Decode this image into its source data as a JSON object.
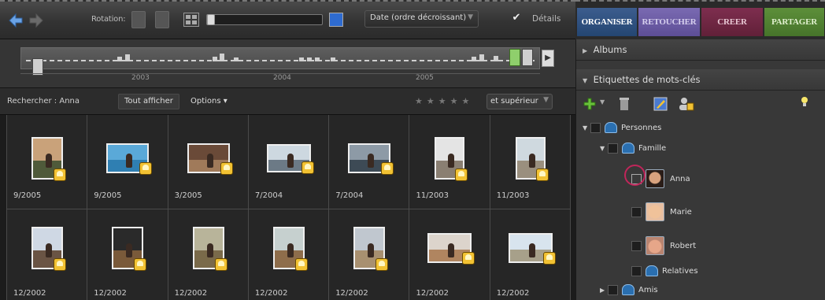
{
  "toolbar": {
    "rotation_label": "Rotation:",
    "sort_selected": "Date (ordre décroissant)",
    "details_label": "Détails",
    "details_checked": true,
    "accent": "#2e6bd0"
  },
  "tabs": [
    {
      "label": "ORGANISER",
      "color": "#3c5d8e"
    },
    {
      "label": "RETOUCHER",
      "color": "#7a6ab2"
    },
    {
      "label": "CREER",
      "color": "#7e2e4f"
    },
    {
      "label": "PARTAGER",
      "color": "#5d8f3a"
    }
  ],
  "timeline": {
    "years": [
      "2003",
      "2004",
      "2005"
    ]
  },
  "search": {
    "label": "Rechercher : Anna",
    "show_all": "Tout afficher",
    "options": "Options",
    "rating_select": "et supérieur"
  },
  "photos": [
    {
      "date": "9/2005"
    },
    {
      "date": "9/2005"
    },
    {
      "date": "3/2005"
    },
    {
      "date": "7/2004"
    },
    {
      "date": "7/2004"
    },
    {
      "date": "11/2003"
    },
    {
      "date": "11/2003"
    },
    {
      "date": "12/2002"
    },
    {
      "date": "12/2002"
    },
    {
      "date": "12/2002"
    },
    {
      "date": "12/2002"
    },
    {
      "date": "12/2002"
    },
    {
      "date": "12/2002"
    },
    {
      "date": "12/2002"
    }
  ],
  "panel": {
    "albums": "Albums",
    "keywords": "Etiquettes de mots-clés",
    "tree": {
      "personnes": "Personnes",
      "famille": "Famille",
      "anna": "Anna",
      "marie": "Marie",
      "robert": "Robert",
      "relatives": "Relatives",
      "amis": "Amis"
    }
  }
}
